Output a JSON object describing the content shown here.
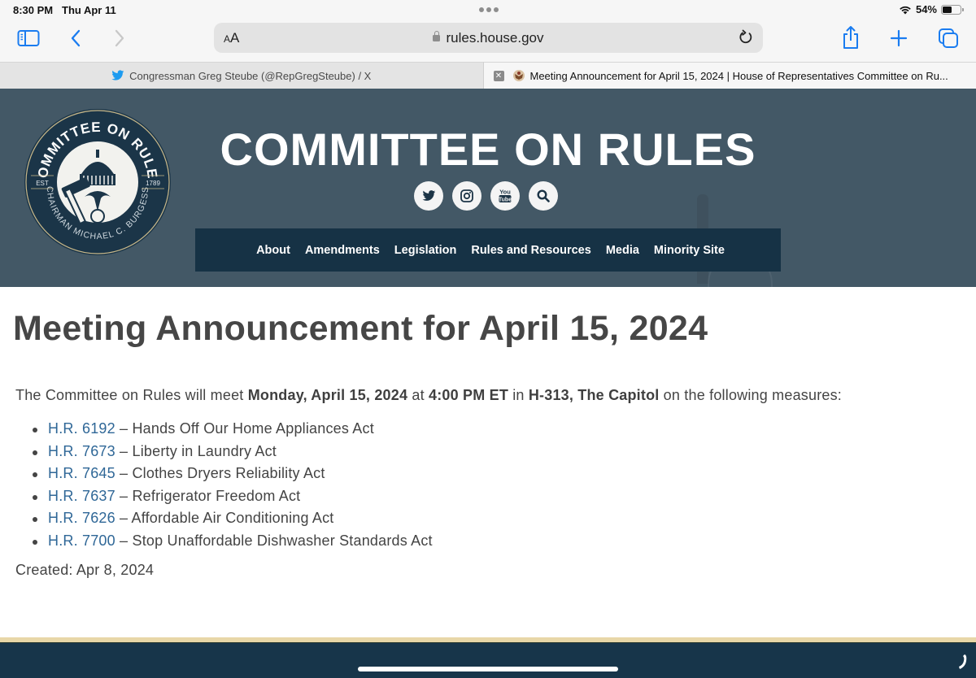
{
  "status_bar": {
    "time": "8:30 PM",
    "date": "Thu Apr 11",
    "battery_percent": "54%",
    "battery_level": 0.54,
    "icons": [
      "wifi-icon",
      "battery-icon"
    ]
  },
  "toolbar": {
    "text_size_label": "AA",
    "url": "rules.house.gov",
    "icons": [
      "sidebar-icon",
      "back-icon",
      "forward-icon",
      "lock-icon",
      "reload-icon",
      "share-icon",
      "new-tab-icon",
      "tabs-overview-icon"
    ]
  },
  "tabs": [
    {
      "title": "Congressman Greg Steube (@RepGregSteube) / X",
      "icon": "twitter-icon",
      "active": false
    },
    {
      "title": "Meeting Announcement for April 15, 2024 | House of Representatives Committee on Ru...",
      "icon": "house-seal-icon",
      "active": true
    }
  ],
  "header": {
    "site_title": "COMMITTEE ON RULES",
    "logo": {
      "top_text": "COMMITTEE ON RULES",
      "bottom_text": "CHAIRMAN MICHAEL C. BURGESS",
      "est_label": "EST",
      "year": "1789"
    },
    "social_icons": [
      "twitter-icon",
      "instagram-icon",
      "youtube-icon",
      "search-icon"
    ],
    "youtube_text_top": "You",
    "youtube_text_bottom": "Tube",
    "nav": [
      "About",
      "Amendments",
      "Legislation",
      "Rules and Resources",
      "Media",
      "Minority Site"
    ]
  },
  "main": {
    "title": "Meeting Announcement for April 15, 2024",
    "intro": {
      "part1": "The Committee on Rules will meet ",
      "date_bold": "Monday, April 15, 2024",
      "part2": " at ",
      "time_bold": "4:00 PM ET",
      "part3": " in ",
      "location_bold": "H-313, The Capitol",
      "part4": " on the following measures:"
    },
    "measures": [
      {
        "bill": "H.R. 6192",
        "separator": " – ",
        "name": "Hands Off Our Home Appliances Act"
      },
      {
        "bill": "H.R. 7673",
        "separator": " – ",
        "name": "Liberty in Laundry Act"
      },
      {
        "bill": "H.R. 7645",
        "separator": " – ",
        "name": "Clothes Dryers Reliability Act"
      },
      {
        "bill": "H.R. 7637",
        "separator": " – ",
        "name": "Refrigerator Freedom Act"
      },
      {
        "bill": "H.R. 7626",
        "separator": " – ",
        "name": "Affordable Air Conditioning Act"
      },
      {
        "bill": "H.R. 7700",
        "separator": " – ",
        "name": "Stop Unaffordable Dishwasher Standards Act"
      }
    ],
    "created": "Created: Apr 8, 2024"
  },
  "colors": {
    "hero_bg": "#435866",
    "nav_bg": "#163245",
    "link": "#2f6797",
    "footer_bg": "#17354a",
    "footer_stripe": "#e8d7a8",
    "safari_blue": "#1a7cf0"
  }
}
